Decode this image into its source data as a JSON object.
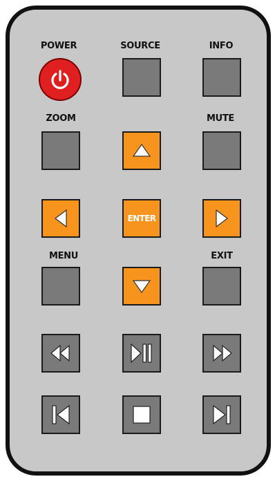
{
  "remote": {
    "labels": {
      "power": "POWER",
      "source": "SOURCE",
      "info": "INFO",
      "zoom": "ZOOM",
      "mute": "MUTE",
      "menu": "MENU",
      "exit": "EXIT"
    },
    "enter_label": "ENTER",
    "icons": {
      "power": "power-icon",
      "up": "arrow-up-icon",
      "down": "arrow-down-icon",
      "left": "arrow-left-icon",
      "right": "arrow-right-icon",
      "rewind": "rewind-icon",
      "play_pause": "play-pause-icon",
      "fast_forward": "fast-forward-icon",
      "previous": "skip-previous-icon",
      "stop": "stop-icon",
      "next": "skip-next-icon"
    },
    "colors": {
      "body": "#c8c8c8",
      "outline": "#111111",
      "gray_button": "#7a7a7a",
      "orange_button": "#f7941d",
      "power_button": "#e02020"
    }
  }
}
